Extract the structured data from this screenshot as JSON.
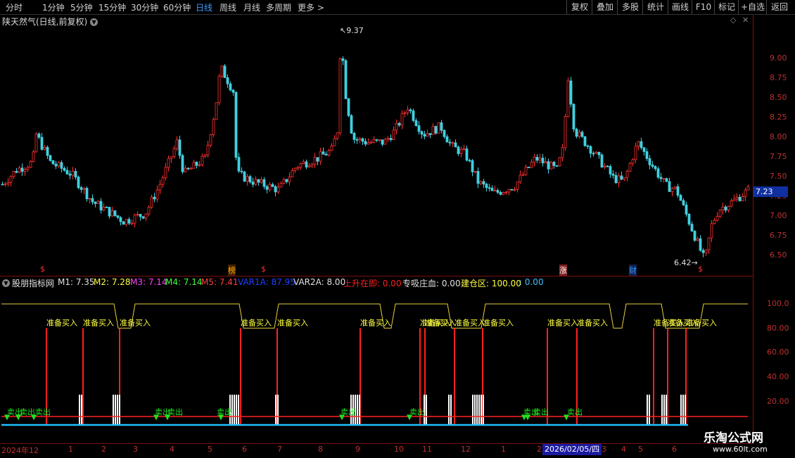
{
  "toolbar": {
    "periods": [
      "分时",
      "1分钟",
      "5分钟",
      "15分钟",
      "30分钟",
      "60分钟",
      "日线",
      "周线",
      "月线",
      "多周期",
      "更多 >"
    ],
    "active_period": "日线",
    "buttons": [
      "复权",
      "叠加",
      "多股",
      "统计",
      "画线",
      "F10",
      "标记",
      "+自选",
      "返回"
    ]
  },
  "main_chart": {
    "title": "陕天然气(日线,前复权)",
    "high_label": "9.37",
    "low_label": "6.42",
    "current_price": "7.23",
    "y_ticks": [
      "9.00",
      "8.75",
      "8.50",
      "8.25",
      "8.00",
      "7.75",
      "7.50",
      "7.25",
      "7.00",
      "6.75",
      "6.50"
    ],
    "ylim": [
      6.35,
      9.5
    ],
    "event_markers": [
      {
        "text": "$",
        "color": "#ff3030"
      },
      {
        "text": "榜",
        "color": "#ffaa00"
      },
      {
        "text": "$",
        "color": "#ff3030"
      },
      {
        "text": "涨",
        "color": "#ffffff"
      },
      {
        "text": "财",
        "color": "#3a9bff"
      },
      {
        "text": "$",
        "color": "#ff3030"
      }
    ]
  },
  "indicator": {
    "name": "股朋指标网",
    "values": [
      {
        "label": "M1: 7.35",
        "color": "#e0e0e0"
      },
      {
        "label": "M2: 7.28",
        "color": "#ffff40"
      },
      {
        "label": "M3: 7.14",
        "color": "#ff40ff"
      },
      {
        "label": "M4: 7.14",
        "color": "#40ff40"
      },
      {
        "label": "M5: 7.41",
        "color": "#ff4040"
      },
      {
        "label": "VAR1A: 87.95",
        "color": "#2040ff"
      },
      {
        "label": "VAR2A: 8.00",
        "color": "#e0e0e0"
      },
      {
        "label": "上升在即: 0.00",
        "color": "#ff2020"
      },
      {
        "label": "专吸庄血: 0.00",
        "color": "#e0e0e0"
      },
      {
        "label": "建仓区: 100.00",
        "color": "#ffff40"
      },
      {
        "label": ": 0.00",
        "color": "#40c0ff"
      }
    ],
    "y_ticks": [
      "100.0",
      "80.00",
      "60.00",
      "40.00",
      "20.00"
    ],
    "buy_label": "准备买入",
    "sell_label": "卖出"
  },
  "time_axis": {
    "labels": [
      "2024年12",
      "1",
      "2",
      "3",
      "4",
      "5",
      "6",
      "7",
      "8",
      "9",
      "10",
      "11",
      "12",
      "1",
      "2",
      "3",
      "4",
      "5",
      "6"
    ],
    "cursor_date": "2026/02/05/四"
  },
  "watermark": {
    "line1": "乐淘公式网",
    "line2": "www.60lt.com"
  },
  "colors": {
    "up": "#ff3030",
    "down": "#40d0e0",
    "axis": "#7a1010"
  }
}
